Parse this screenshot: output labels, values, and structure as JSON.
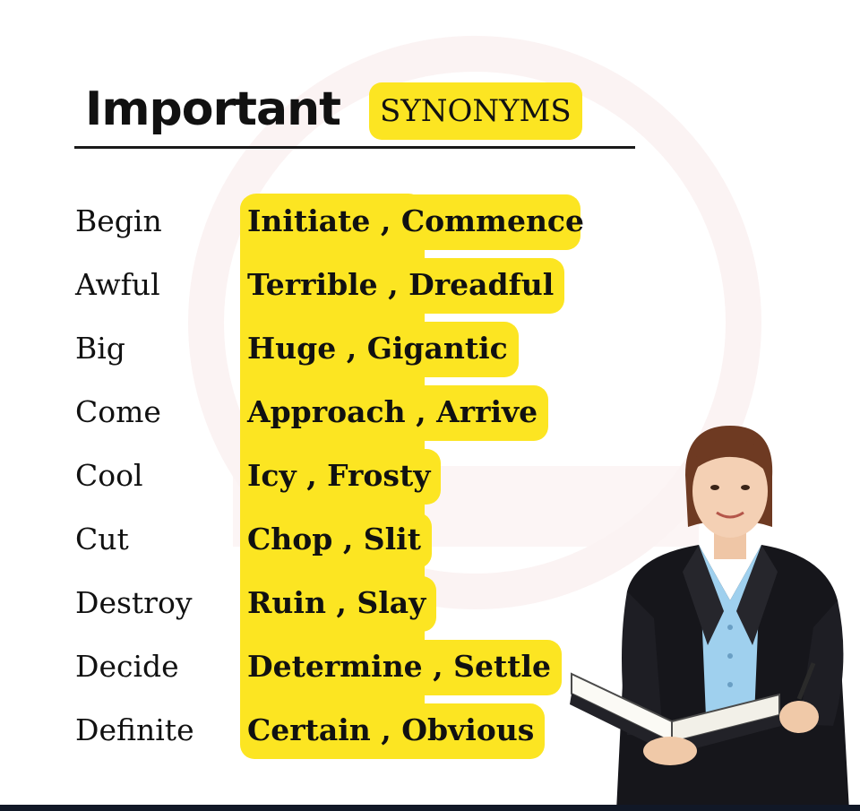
{
  "header": {
    "title_word": "Important",
    "title_badge": "SYNONYMS"
  },
  "rows": [
    {
      "word": "Begin",
      "synonyms": "Initiate , Commence"
    },
    {
      "word": "Awful",
      "synonyms": "Terrible , Dreadful"
    },
    {
      "word": "Big",
      "synonyms": "Huge , Gigantic"
    },
    {
      "word": "Come",
      "synonyms": "Approach  , Arrive"
    },
    {
      "word": "Cool",
      "synonyms": "Icy , Frosty"
    },
    {
      "word": "Cut",
      "synonyms": "Chop , Slit"
    },
    {
      "word": "Destroy",
      "synonyms": "Ruin , Slay"
    },
    {
      "word": "Decide",
      "synonyms": "Determine , Settle"
    },
    {
      "word": "Definite",
      "synonyms": "Certain , Obvious"
    }
  ],
  "colors": {
    "highlight": "#fce522",
    "text": "#111111",
    "jacket": "#16161b",
    "shirt": "#9fd0ee"
  },
  "icons": {
    "figure": "teacher-holding-book-icon"
  }
}
